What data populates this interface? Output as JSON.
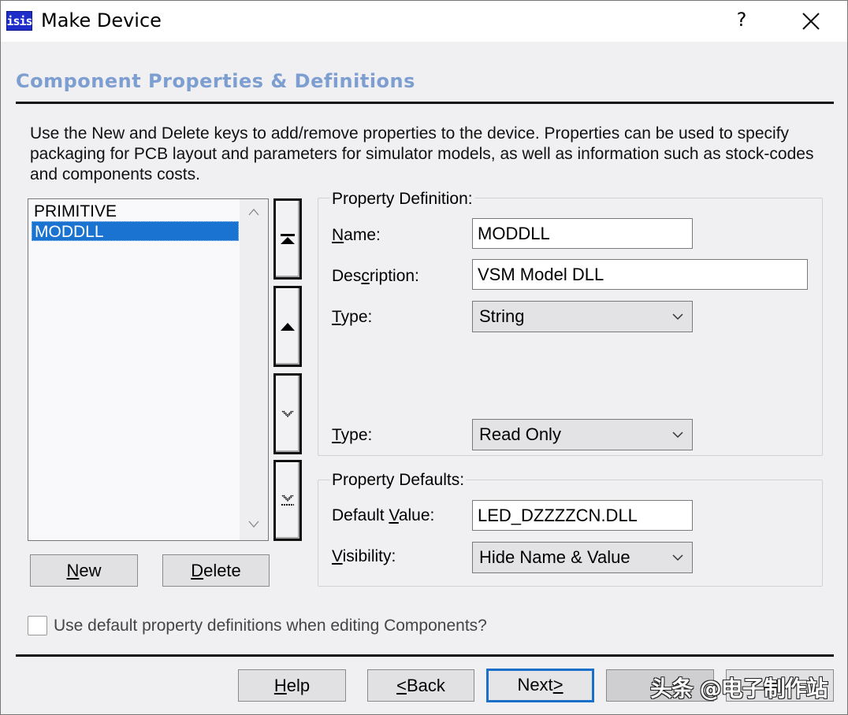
{
  "window": {
    "title": "Make Device",
    "app_icon_text": "isis",
    "help_button": "?",
    "close_icon": "close-icon"
  },
  "page": {
    "heading": "Component Properties & Definitions",
    "intro": "Use the New and Delete keys to add/remove properties to the device. Properties can be used to specify packaging for PCB layout and parameters for simulator models, as well as information such as stock-codes and components costs."
  },
  "property_list": {
    "items": [
      {
        "label": "PRIMITIVE",
        "selected": false
      },
      {
        "label": "MODDLL",
        "selected": true
      }
    ],
    "scroll_up_icon": "chevron-up-icon",
    "scroll_down_icon": "chevron-down-icon"
  },
  "move_buttons": [
    {
      "name": "move-to-top-button",
      "icon": "move-top-icon"
    },
    {
      "name": "move-up-button",
      "icon": "move-up-icon"
    },
    {
      "name": "move-down-button",
      "icon": "move-down-icon"
    },
    {
      "name": "move-to-bottom-button",
      "icon": "move-bottom-icon"
    }
  ],
  "list_buttons": {
    "new": {
      "label_accel": "N",
      "label_rest": "ew"
    },
    "delete": {
      "label_accel": "D",
      "label_rest": "elete"
    }
  },
  "property_definition": {
    "group_label": "Property Definition:",
    "name": {
      "label_accel": "N",
      "label_rest": "ame:",
      "value": "MODDLL"
    },
    "description": {
      "label_pre": "Des",
      "label_accel": "c",
      "label_rest": "ription:",
      "value": "VSM Model DLL"
    },
    "type": {
      "label_accel": "T",
      "label_rest": "ype:",
      "value": "String"
    },
    "type2": {
      "label_accel": "T",
      "label_rest": "ype:",
      "value": "Read Only"
    }
  },
  "property_defaults": {
    "group_label": "Property Defaults:",
    "default_value": {
      "label_pre": "Default ",
      "label_accel": "V",
      "label_rest": "alue:",
      "value": "LED_DZZZZCN.DLL"
    },
    "visibility": {
      "label_accel": "V",
      "label_rest": "isibility:",
      "value": "Hide Name & Value"
    }
  },
  "options": {
    "use_default_definitions": {
      "label": "Use default property definitions when editing Components?",
      "checked": false
    }
  },
  "footer": {
    "help": {
      "label_accel": "H",
      "label_rest": "elp"
    },
    "back": {
      "label_accel": "<",
      "label_rest": "Back"
    },
    "next": {
      "label_pre": "Next",
      "label_accel": ">"
    },
    "watermark": "头条 @电子制作站"
  },
  "colors": {
    "heading": "#7d9ed0",
    "selection": "#1a73d0",
    "default_button_border": "#1a6fc9",
    "app_icon_bg": "#1f2ec8"
  }
}
